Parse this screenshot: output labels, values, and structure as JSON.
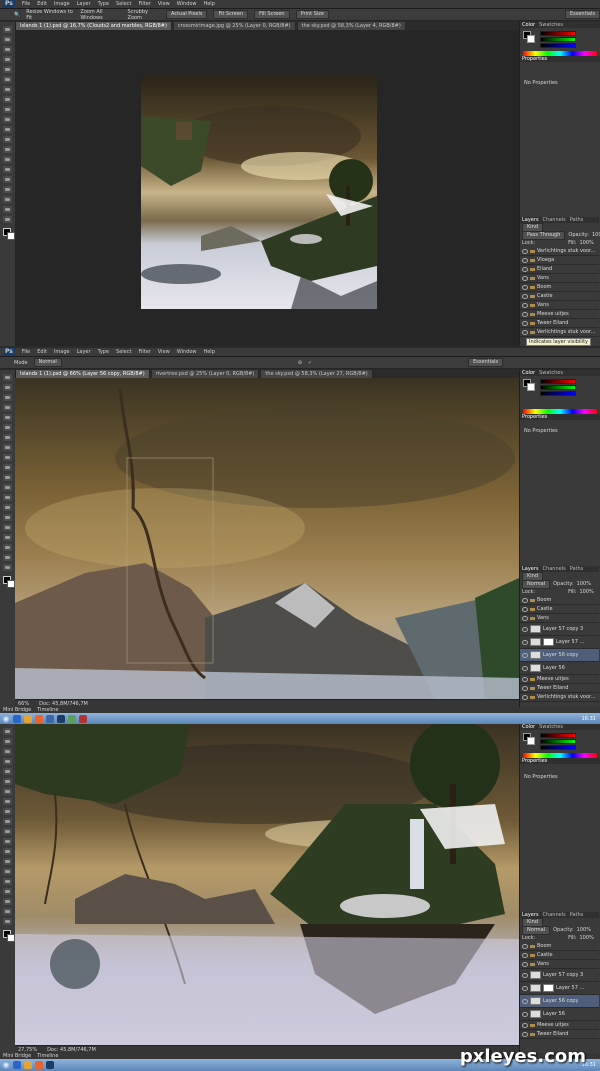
{
  "menu": {
    "logo": "Ps",
    "items": [
      "File",
      "Edit",
      "Image",
      "Layer",
      "Type",
      "Select",
      "Filter",
      "View",
      "Window",
      "Help"
    ]
  },
  "options1": {
    "resize": "Resize Windows to Fit",
    "zoom_all": "Zoom All Windows",
    "scrubby": "Scrubby Zoom",
    "actual": "Actual Pixels",
    "fit": "Fit Screen",
    "fill": "Fill Screen",
    "print": "Print Size",
    "workspace": "Essentials"
  },
  "options2": {
    "mode": "Mode",
    "normal": "Normal",
    "workspace": "Essentials"
  },
  "tabs1": [
    "Islands 1 (1).psd @ 16,7% (Clouds2 and marbles, RGB/8#)",
    "crossmirimage.jpg @ 25% (Layer 0, RGB/8#)",
    "the sky.psd @ 58,3% (Layer 4, RGB/8#)"
  ],
  "tabs2": [
    "Islands 1 (1).psd @ 66% (Layer 56 copy, RGB/8#)",
    "rivertree.psd @ 25% (Layer 0, RGB/8#)",
    "the sky.psd @ 58,3% (Layer 27, RGB/8#)"
  ],
  "panels": {
    "color_tab": "Color",
    "swatches_tab": "Swatches",
    "properties_tab": "Properties",
    "no_properties": "No Properties",
    "layers_tab": "Layers",
    "channels_tab": "Channels",
    "paths_tab": "Paths",
    "kind": "Kind",
    "opacity_label": "Opacity:",
    "opacity_val": "100%",
    "fill_label": "Fill:",
    "fill_val": "100%",
    "lock_label": "Lock:"
  },
  "layers1": {
    "blend": "Pass Through",
    "rows": [
      "Verlichtings stuk voor...",
      "Vloega",
      "Eiland",
      "Vans",
      "Boom",
      "Castle",
      "Vans",
      "Meeve uitjes",
      "Tweer Eiland",
      "Verlichtings stuk voor..."
    ],
    "tooltip": "Indicates layer visibility"
  },
  "layers2": {
    "blend": "Normal",
    "rows": [
      "Boom",
      "Castle",
      "Vans",
      "Layer 57 copy 3",
      "Layer 57 ...",
      "Layer 56 copy",
      "Layer 56",
      "Meeve uitjes",
      "Tweer Eiland",
      "Verlichtings stuk voor..."
    ]
  },
  "layers3": {
    "blend": "Normal",
    "rows": [
      "Boom",
      "Castle",
      "Vans",
      "Layer 57 copy 3",
      "Layer 57 ...",
      "Layer 56 copy",
      "Layer 56",
      "Meeve uitjes",
      "Tweer Eiland"
    ]
  },
  "status2": {
    "zoom": "66%",
    "doc": "Doc: 45,8M/746,7M"
  },
  "status3": {
    "zoom": "27,75%",
    "doc": "Doc: 45,8M/746,7M"
  },
  "bridge": {
    "a": "Mini Bridge",
    "b": "Timeline"
  },
  "clock": "16:31",
  "clock2": "16:31",
  "watermark": "pxleyes.com",
  "colors": {
    "ui_bg": "#2b2b2b",
    "panel": "#3a3a3a",
    "selection": "#4f5f7b",
    "taskbar": "#5c86b8"
  }
}
